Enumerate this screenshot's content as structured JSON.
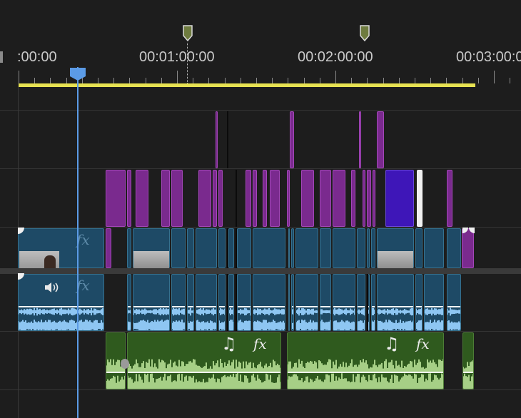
{
  "timecodes": [
    ":00:00",
    "00:01:00:00",
    "00:02:00:00",
    "00:03:00:00"
  ],
  "icons": {
    "marker": "marker-icon",
    "audio_clip": "speaker-icon",
    "music": "music-note-icon",
    "effects": "fx-icon"
  },
  "glyphs": {
    "fx": "fx",
    "music": "♫"
  },
  "colors": {
    "work_area": "#e7e252",
    "playhead": "#5b9be6",
    "marker": "#6e7b3f",
    "video_clip": "#1e4a66",
    "graphics_clip": "#7a2a8e",
    "color_matte": "#3e16b8",
    "audio_waveform": "#8ec6f2",
    "music_clip": "#2f5a1e",
    "music_waveform": "#a6cf86"
  }
}
